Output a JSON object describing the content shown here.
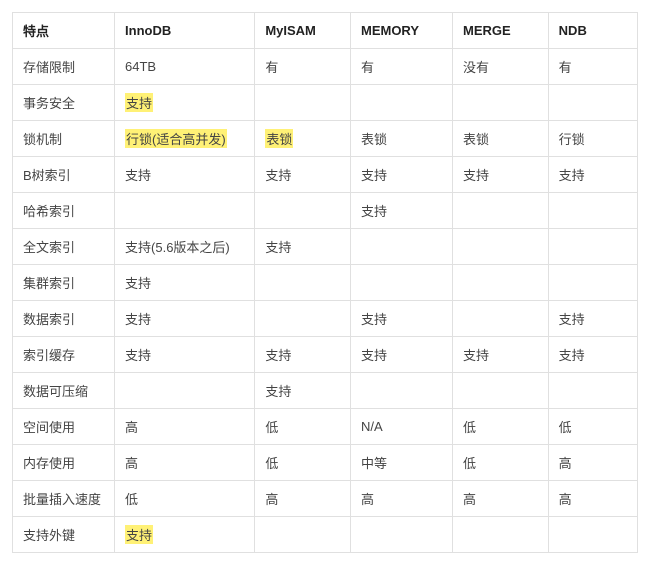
{
  "chart_data": {
    "type": "table",
    "title": "",
    "columns": [
      "特点",
      "InnoDB",
      "MyISAM",
      "MEMORY",
      "MERGE",
      "NDB"
    ],
    "highlights": [
      {
        "row": 1,
        "col": 1
      },
      {
        "row": 2,
        "col": 1
      },
      {
        "row": 2,
        "col": 2
      },
      {
        "row": 13,
        "col": 1
      }
    ],
    "rows": [
      [
        "存储限制",
        "64TB",
        "有",
        "有",
        "没有",
        "有"
      ],
      [
        "事务安全",
        "支持",
        "",
        "",
        "",
        ""
      ],
      [
        "锁机制",
        "行锁(适合高并发)",
        "表锁",
        "表锁",
        "表锁",
        "行锁"
      ],
      [
        "B树索引",
        "支持",
        "支持",
        "支持",
        "支持",
        "支持"
      ],
      [
        "哈希索引",
        "",
        "",
        "支持",
        "",
        ""
      ],
      [
        "全文索引",
        "支持(5.6版本之后)",
        "支持",
        "",
        "",
        ""
      ],
      [
        "集群索引",
        "支持",
        "",
        "",
        "",
        ""
      ],
      [
        "数据索引",
        "支持",
        "",
        "支持",
        "",
        "支持"
      ],
      [
        "索引缓存",
        "支持",
        "支持",
        "支持",
        "支持",
        "支持"
      ],
      [
        "数据可压缩",
        "",
        "支持",
        "",
        "",
        ""
      ],
      [
        "空间使用",
        "高",
        "低",
        "N/A",
        "低",
        "低"
      ],
      [
        "内存使用",
        "高",
        "低",
        "中等",
        "低",
        "高"
      ],
      [
        "批量插入速度",
        "低",
        "高",
        "高",
        "高",
        "高"
      ],
      [
        "支持外键",
        "支持",
        "",
        "",
        "",
        ""
      ]
    ]
  }
}
